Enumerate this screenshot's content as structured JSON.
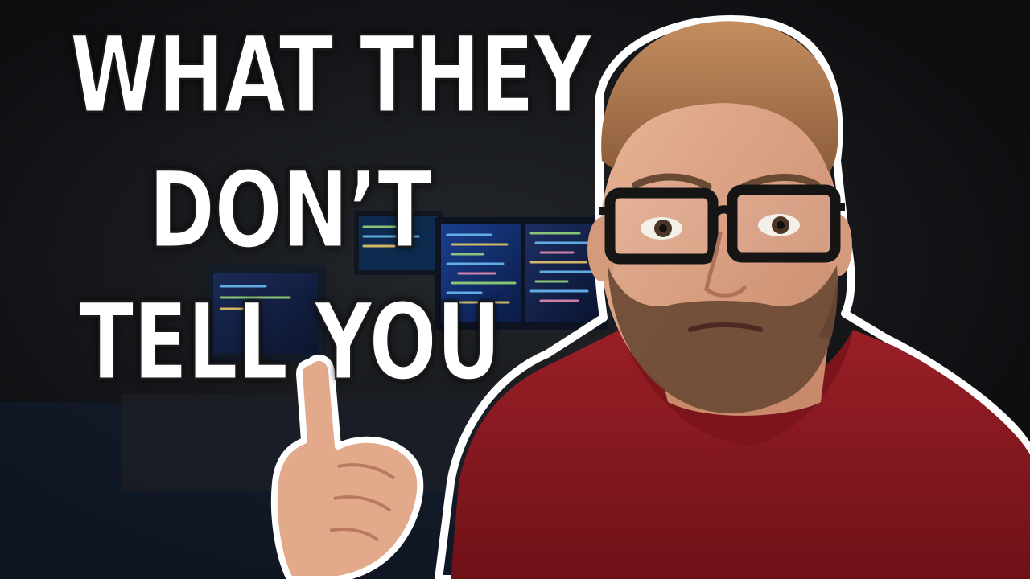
{
  "thumbnail": {
    "title_lines": [
      "WHAT THEY",
      "DON’T",
      "TELL YOU"
    ]
  },
  "colors": {
    "background": "#0f1012",
    "title_text": "#ffffff",
    "hoodie": "#8e1b22",
    "hair": "#b07a4f",
    "beard": "#6b4a35",
    "monitor_glow": "#2f6fd6"
  }
}
